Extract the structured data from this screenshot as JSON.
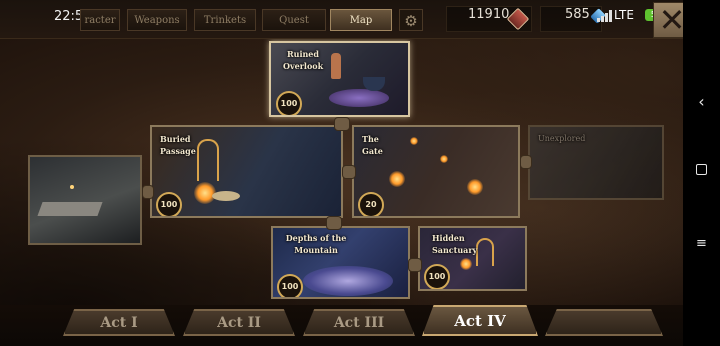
{
  "status_bar": {
    "time": "22:56",
    "network": "LTE",
    "battery": "56"
  },
  "nav_tabs": [
    {
      "label": "Character",
      "visible_label": "racter",
      "active": false
    },
    {
      "label": "Weapons",
      "active": false
    },
    {
      "label": "Trinkets",
      "active": false
    },
    {
      "label": "Quest",
      "active": false
    },
    {
      "label": "Map",
      "active": true
    }
  ],
  "resources": {
    "primary_value": "11910",
    "secondary_value": "585",
    "primary_icon": "red-gem-icon",
    "secondary_icon": "blue-crystal-icon"
  },
  "close_icon": "close-icon",
  "map_tiles": [
    {
      "id": "ruined-overlook",
      "label": "Ruined Overlook",
      "level": "100",
      "explored": true
    },
    {
      "id": "buried-passage",
      "label": "Buried Passage",
      "level": "100",
      "explored": true
    },
    {
      "id": "the-gate",
      "label": "The Gate",
      "level": "20",
      "explored": true
    },
    {
      "id": "unexplored",
      "label": "Unexplored",
      "level": "",
      "explored": false
    },
    {
      "id": "depths-of-the-mountain",
      "label": "Depths of the Mountain",
      "level": "100",
      "explored": true
    },
    {
      "id": "hidden-sanctuary",
      "label": "Hidden Sanctuary",
      "level": "100",
      "explored": true
    }
  ],
  "act_tabs": [
    {
      "label": "Act I",
      "active": false
    },
    {
      "label": "Act II",
      "active": false
    },
    {
      "label": "Act III",
      "active": false
    },
    {
      "label": "Act IV",
      "active": true
    },
    {
      "label": "",
      "active": false
    }
  ],
  "colors": {
    "accent_gold": "#d2a957",
    "frame": "#8c7a5c",
    "battery_green": "#5fc22f"
  },
  "android_nav": [
    "back-icon",
    "home-icon",
    "recents-icon"
  ]
}
